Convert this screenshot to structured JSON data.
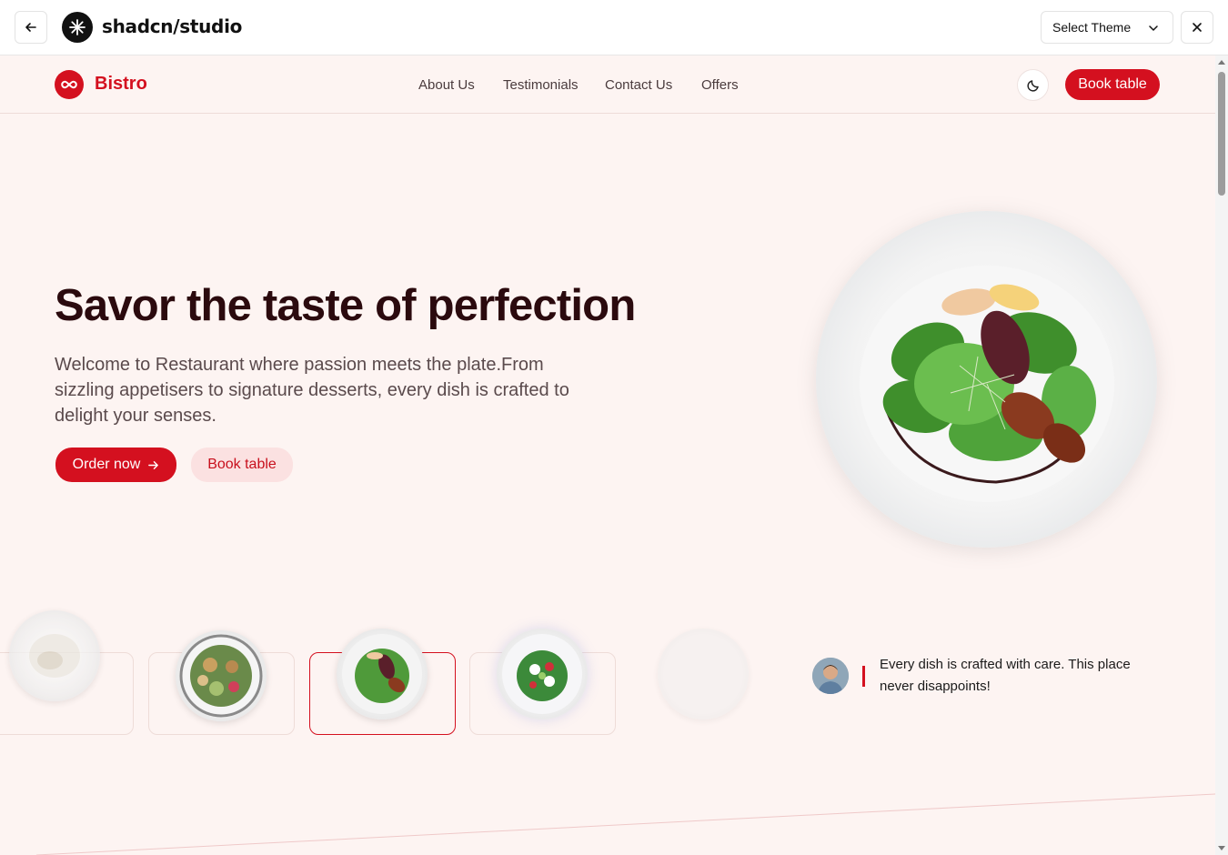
{
  "studio": {
    "back_icon": "arrow-left-icon",
    "title": "shadcn/studio",
    "theme_select": "Select Theme",
    "close_icon": "close-icon"
  },
  "site": {
    "brand": "Bistro",
    "nav": [
      "About Us",
      "Testimonials",
      "Contact Us",
      "Offers"
    ],
    "theme_toggle_icon": "moon-icon",
    "book_table": "Book table"
  },
  "hero": {
    "title": "Savor the taste of perfection",
    "description": "Welcome to Restaurant where passion meets the plate.From sizzling appetisers to signature desserts, every dish is crafted to delight your senses.",
    "order_now": "Order now",
    "book_table": "Book table"
  },
  "testimonial": {
    "quote": "Every dish is crafted with care. This place never disappoints!"
  },
  "colors": {
    "accent": "#d4101f",
    "page_bg": "#fdf4f2",
    "heading": "#2b0a0e"
  }
}
